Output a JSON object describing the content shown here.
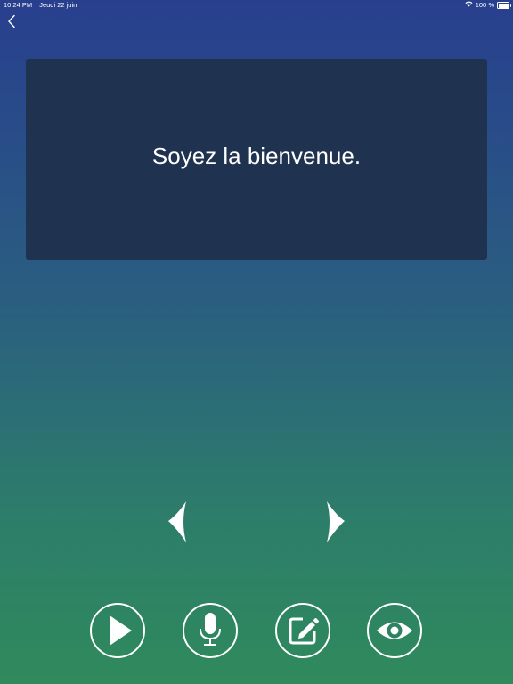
{
  "status_bar": {
    "time": "10:24 PM",
    "date": "Jeudi 22 juin",
    "battery": "100 %"
  },
  "icons": {
    "back": "chevron-left-icon",
    "wifi": "wifi-icon",
    "battery": "battery-icon",
    "prev": "caret-left-icon",
    "next": "caret-right-icon",
    "play": "play-icon",
    "mic": "microphone-icon",
    "edit": "edit-icon",
    "view": "eye-icon"
  },
  "card": {
    "text": "Soyez la bienvenue."
  },
  "colors": {
    "gradient_top": "#283f8e",
    "gradient_bottom": "#2f8a5c",
    "card_background": "#1f324f",
    "foreground": "#ffffff"
  }
}
